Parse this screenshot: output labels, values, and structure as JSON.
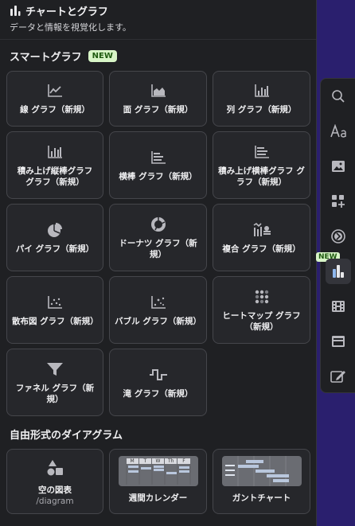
{
  "header": {
    "title": "チャートとグラフ",
    "subtitle": "データと情報を視覚化します。"
  },
  "smart": {
    "title": "スマートグラフ",
    "badge": "NEW",
    "cards": [
      {
        "label": "線 グラフ（新規）",
        "icon": "line-chart-icon"
      },
      {
        "label": "面 グラフ（新規）",
        "icon": "area-chart-icon"
      },
      {
        "label": "列 グラフ（新規）",
        "icon": "column-chart-icon"
      },
      {
        "label": "積み上げ縦棒グラフ グラフ（新規）",
        "icon": "stacked-column-icon"
      },
      {
        "label": "横棒 グラフ（新規）",
        "icon": "bar-chart-icon"
      },
      {
        "label": "積み上げ横棒グラフ グラフ（新規）",
        "icon": "stacked-bar-icon"
      },
      {
        "label": "パイ グラフ（新規）",
        "icon": "pie-chart-icon"
      },
      {
        "label": "ドーナツ グラフ（新規）",
        "icon": "donut-chart-icon"
      },
      {
        "label": "複合 グラフ（新規）",
        "icon": "combo-chart-icon"
      },
      {
        "label": "散布図 グラフ（新規）",
        "icon": "scatter-chart-icon"
      },
      {
        "label": "バブル グラフ（新規）",
        "icon": "bubble-chart-icon"
      },
      {
        "label": "ヒートマップ グラフ（新規）",
        "icon": "heatmap-icon"
      },
      {
        "label": "ファネル グラフ（新規）",
        "icon": "funnel-chart-icon"
      },
      {
        "label": "滝 グラフ（新規）",
        "icon": "waterfall-chart-icon"
      }
    ]
  },
  "freeform": {
    "title": "自由形式のダイアグラム",
    "cards": [
      {
        "label": "空の図表",
        "sub": "/diagram",
        "icon": "shapes-icon"
      },
      {
        "label": "週間カレンダー",
        "icon": "calendar-thumbnail"
      },
      {
        "label": "ガントチャート",
        "icon": "gantt-thumbnail"
      }
    ],
    "calendar_days": [
      "M",
      "T",
      "W",
      "Th",
      "F"
    ]
  },
  "toolbar": {
    "badge": "NEW",
    "items": [
      "search-icon",
      "text-icon",
      "image-icon",
      "add-component-icon",
      "toggle-icon",
      "chart-icon",
      "video-icon",
      "embed-icon",
      "edit-icon"
    ]
  },
  "colors": {
    "panel": "#1f2023",
    "card": "#26272b",
    "card_border": "#45464b",
    "badge_bg": "#d8f5c7",
    "badge_text": "#1f5a10",
    "background": "#2a1f6e"
  }
}
